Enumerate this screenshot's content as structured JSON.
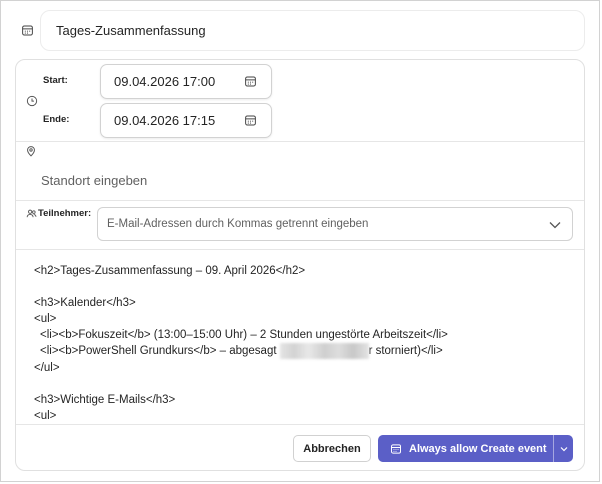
{
  "title": {
    "icon": "calendar-icon",
    "value": "Tages-Zusammenfassung"
  },
  "time": {
    "icon": "clock-icon",
    "start_label": "Start:",
    "start_value": "09.04.2026 17:00",
    "end_label": "Ende:",
    "end_value": "09.04.2026 17:15",
    "picker_icon": "calendar-icon"
  },
  "location": {
    "icon": "location-pin-icon",
    "placeholder": "Standort eingeben"
  },
  "attendees": {
    "icon": "people-icon",
    "label": "Teilnehmer:",
    "placeholder": "E-Mail-Adressen durch Kommas getrennt eingeben",
    "dropdown_icon": "chevron-down-icon"
  },
  "body": {
    "lines": [
      "<h2>Tages-Zusammenfassung – 09. April 2026</h2>",
      "<h3>Kalender</h3>",
      "<ul>",
      "<li><b>Fokuszeit</b> (13:00–15:00 Uhr) – 2 Stunden ungestörte Arbeitszeit</li>",
      {
        "before": "<li><b>PowerShell Grundkurs</b> – abgesagt",
        "after": "r storniert)</li>"
      },
      "</ul>",
      "<h3>Wichtige E-Mails</h3>",
      "<ul>"
    ]
  },
  "footer": {
    "cancel_label": "Abbrechen",
    "confirm_label": "Always allow Create event",
    "confirm_icon": "calendar-icon",
    "split_icon": "chevron-down-icon"
  },
  "colors": {
    "primary": "#5b5fc7",
    "text": "#242424",
    "placeholder": "#616161",
    "border": "#e0e0e0"
  }
}
